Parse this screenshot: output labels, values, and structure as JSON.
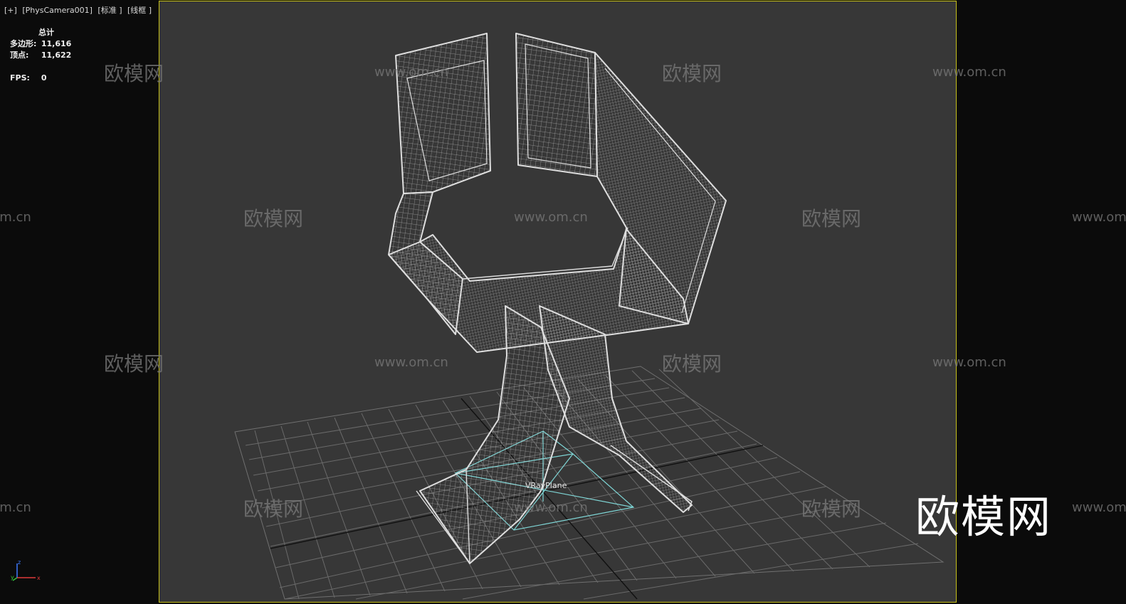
{
  "viewport": {
    "label_parts": [
      "[+]",
      "[PhysCamera001]",
      "[标准 ]",
      "[线框 ]"
    ]
  },
  "stats": {
    "header": "总计",
    "polygons_label": "多边形:",
    "polygons_value": "11,616",
    "vertices_label": "顶点:",
    "vertices_value": "11,622",
    "fps_label": "FPS:",
    "fps_value": "0"
  },
  "watermarks": {
    "text_cn": "欧模网",
    "text_url": "www.om.cn"
  },
  "scene_objects": {
    "light_name": "VRayPlane"
  },
  "axis_gizmo": {
    "x": "x",
    "y": "y",
    "z": "z"
  },
  "logo_text": "欧模网",
  "colors": {
    "viewport_bg": "#373737",
    "safe_frame": "#c8c21a",
    "wire": "#d8d8d8",
    "grid": "#6a6a6a",
    "light": "#7fd6d6",
    "watermark": "#7a7a7a"
  }
}
